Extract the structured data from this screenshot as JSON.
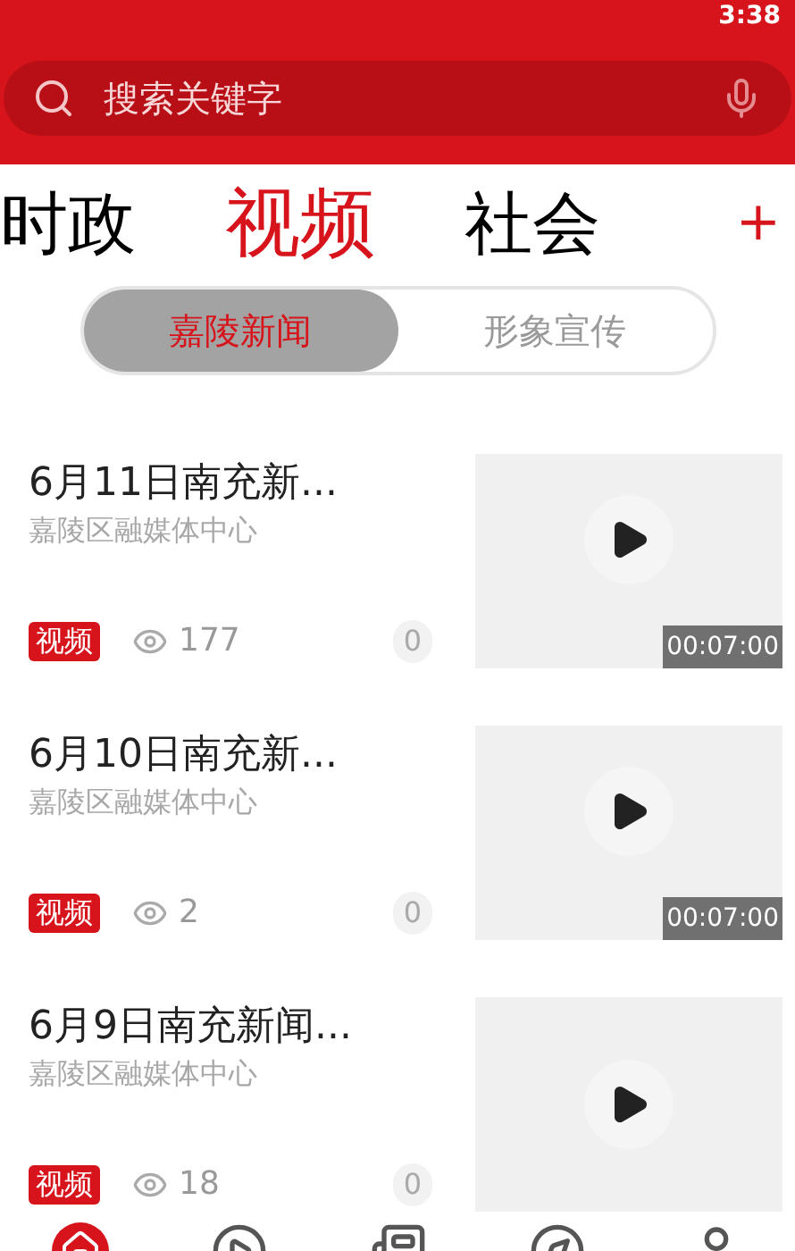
{
  "status_bar": {
    "time": "3:38"
  },
  "search": {
    "placeholder": "搜索关键字"
  },
  "channels": [
    {
      "label": "时政",
      "selected": false
    },
    {
      "label": "视频",
      "selected": true
    },
    {
      "label": "社会",
      "selected": false
    }
  ],
  "add_channel": "+",
  "segments": [
    {
      "label": "嘉陵新闻",
      "selected": true
    },
    {
      "label": "形象宣传",
      "selected": false
    }
  ],
  "items": [
    {
      "title": "6月11日南充新...",
      "source": "嘉陵区融媒体中心",
      "tag": "视频",
      "views": "177",
      "comments": "0",
      "duration": "00:07:00"
    },
    {
      "title": "6月10日南充新...",
      "source": "嘉陵区融媒体中心",
      "tag": "视频",
      "views": "2",
      "comments": "0",
      "duration": "00:07:00"
    },
    {
      "title": "6月9日南充新闻...",
      "source": "嘉陵区融媒体中心",
      "tag": "视频",
      "views": "18",
      "comments": "0"
    }
  ]
}
